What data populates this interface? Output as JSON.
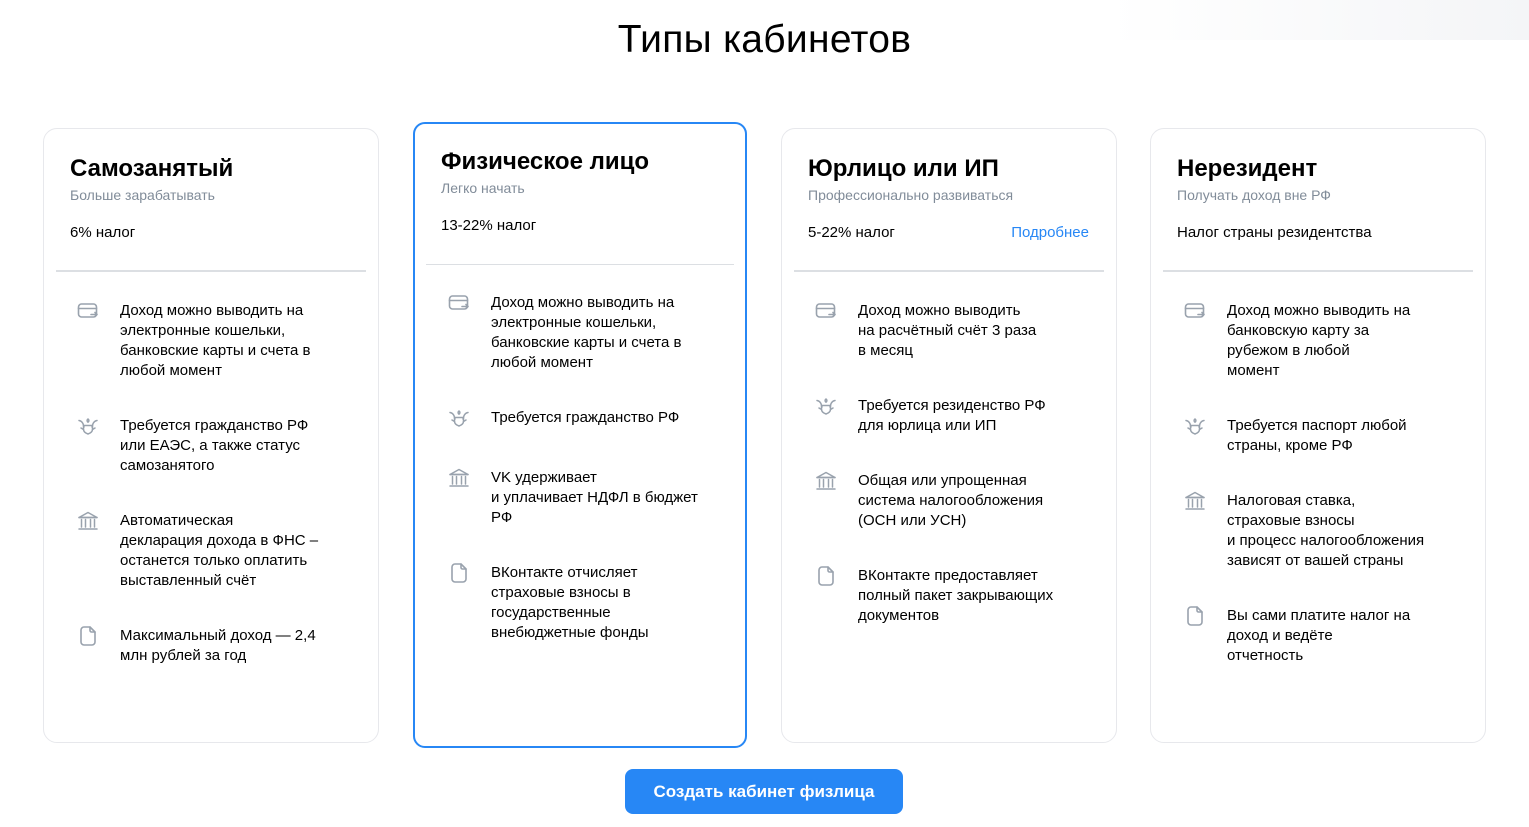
{
  "page": {
    "title": "Типы кабинетов"
  },
  "colors": {
    "accent": "#2787f5",
    "icon": "#99a2ad",
    "border": "#e7e8ec",
    "subtitle": "#818c99"
  },
  "cards": [
    {
      "title": "Самозанятый",
      "subtitle": "Больше зарабатывать",
      "tax": "6% налог",
      "features": [
        {
          "icon": "card-transfer-icon",
          "text": "Доход можно выводить на\nэлектронные кошельки,\nбанковские карты и счета в\nлюбой момент"
        },
        {
          "icon": "coat-of-arms-icon",
          "text": "Требуется гражданство РФ\nили ЕАЭС, а также статус\nсамозанятого"
        },
        {
          "icon": "bank-icon",
          "text": "Автоматическая\nдекларация дохода в ФНС –\nостанется только оплатить\nвыставленный счёт"
        },
        {
          "icon": "document-icon",
          "text": "Максимальный доход — 2,4\nмлн рублей за год"
        }
      ]
    },
    {
      "title": "Физическое лицо",
      "subtitle": "Легко начать",
      "tax": "13-22% налог",
      "selected": true,
      "features": [
        {
          "icon": "card-transfer-icon",
          "text": "Доход можно выводить на\nэлектронные кошельки,\nбанковские карты и счета в\nлюбой момент"
        },
        {
          "icon": "coat-of-arms-icon",
          "text": "Требуется гражданство РФ"
        },
        {
          "icon": "bank-icon",
          "text": "VK удерживает\nи уплачивает НДФЛ в бюджет\nРФ"
        },
        {
          "icon": "document-icon",
          "text": "ВКонтакте отчисляет\nстраховые взносы в\nгосударственные\nвнебюджетные фонды"
        }
      ]
    },
    {
      "title": "Юрлицо или ИП",
      "subtitle": "Профессионально развиваться",
      "tax": "5-22% налог",
      "more_link": "Подробнее",
      "features": [
        {
          "icon": "card-transfer-icon",
          "text": "Доход можно выводить\nна расчётный счёт 3 раза\nв месяц"
        },
        {
          "icon": "coat-of-arms-icon",
          "text": "Требуется резиденство РФ\nдля юрлица или ИП"
        },
        {
          "icon": "bank-icon",
          "text": "Общая или упрощенная\nсистема налогообложения\n(ОСН или УСН)"
        },
        {
          "icon": "document-icon",
          "text": "ВКонтакте предоставляет\nполный пакет закрывающих\nдокументов"
        }
      ]
    },
    {
      "title": "Нерезидент",
      "subtitle": "Получать доход вне РФ",
      "tax": "Налог страны резидентства",
      "features": [
        {
          "icon": "card-transfer-icon",
          "text": "Доход можно выводить на\nбанковскую карту за\nрубежом в любой\nмомент"
        },
        {
          "icon": "coat-of-arms-icon",
          "text": "Требуется паспорт любой\nстраны, кроме РФ"
        },
        {
          "icon": "bank-icon",
          "text": "Налоговая ставка,\nстраховые взносы\nи процесс налогообложения\nзависят от вашей страны"
        },
        {
          "icon": "document-icon",
          "text": "Вы сами платите налог на\nдоход и ведёте\nотчетность"
        }
      ]
    }
  ],
  "cta": {
    "label": "Создать кабинет физлица"
  }
}
